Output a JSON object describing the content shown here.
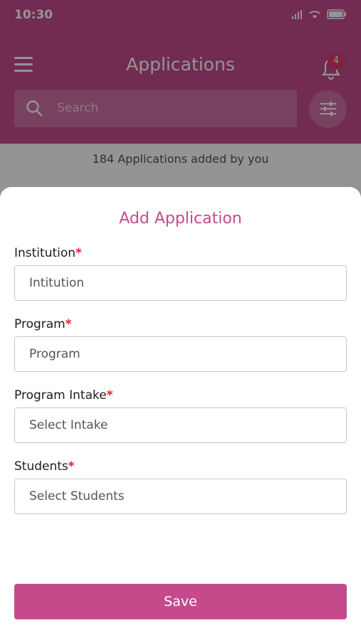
{
  "status_bar": {
    "time": "10:30"
  },
  "header": {
    "title": "Applications",
    "notification_count": "4",
    "search_placeholder": "Search"
  },
  "summary": {
    "text": "184 Applications added by you"
  },
  "sheet": {
    "title": "Add Application",
    "fields": [
      {
        "label": "Institution",
        "required_mark": "*",
        "placeholder": "Intitution"
      },
      {
        "label": "Program",
        "required_mark": "*",
        "placeholder": "Program"
      },
      {
        "label": "Program Intake",
        "required_mark": "*",
        "placeholder": "Select Intake"
      },
      {
        "label": "Students",
        "required_mark": "*",
        "placeholder": "Select Students"
      }
    ],
    "save_label": "Save"
  },
  "colors": {
    "brand": "#c54a8c",
    "required": "#e0202a",
    "badge": "#e03a6d"
  }
}
